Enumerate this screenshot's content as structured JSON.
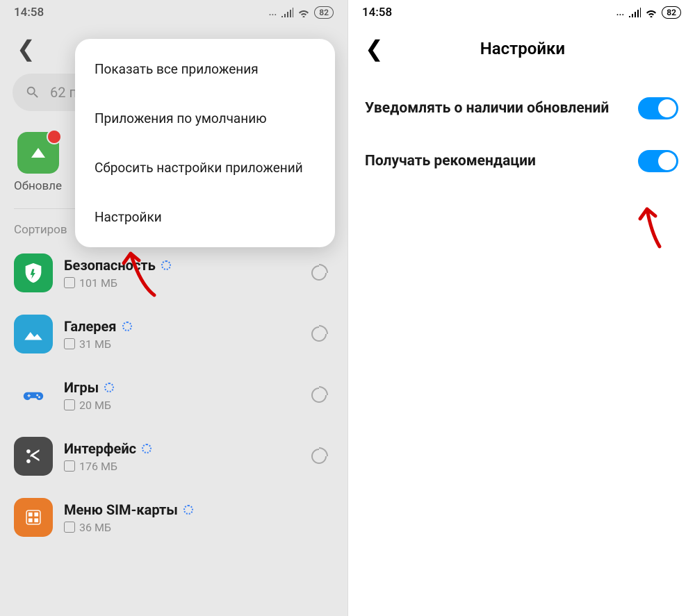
{
  "statusBar": {
    "time": "14:58",
    "dots": "...",
    "battery": "82"
  },
  "left": {
    "searchText": "62 п",
    "shortcutLabel": "Обновле",
    "sortLabel": "Сортиров",
    "menu": {
      "items": [
        "Показать все приложения",
        "Приложения по умолчанию",
        "Сбросить настройки приложений",
        "Настройки"
      ]
    },
    "apps": [
      {
        "name": "Безопасность",
        "size": "101 МБ"
      },
      {
        "name": "Галерея",
        "size": "31 МБ"
      },
      {
        "name": "Игры",
        "size": "20 МБ"
      },
      {
        "name": "Интерфейс",
        "size": "176 МБ"
      },
      {
        "name": "Меню SIM-карты",
        "size": "36 МБ"
      }
    ]
  },
  "right": {
    "title": "Настройки",
    "settings": [
      {
        "label": "Уведомлять о наличии обновлений"
      },
      {
        "label": "Получать рекомендации"
      }
    ]
  }
}
